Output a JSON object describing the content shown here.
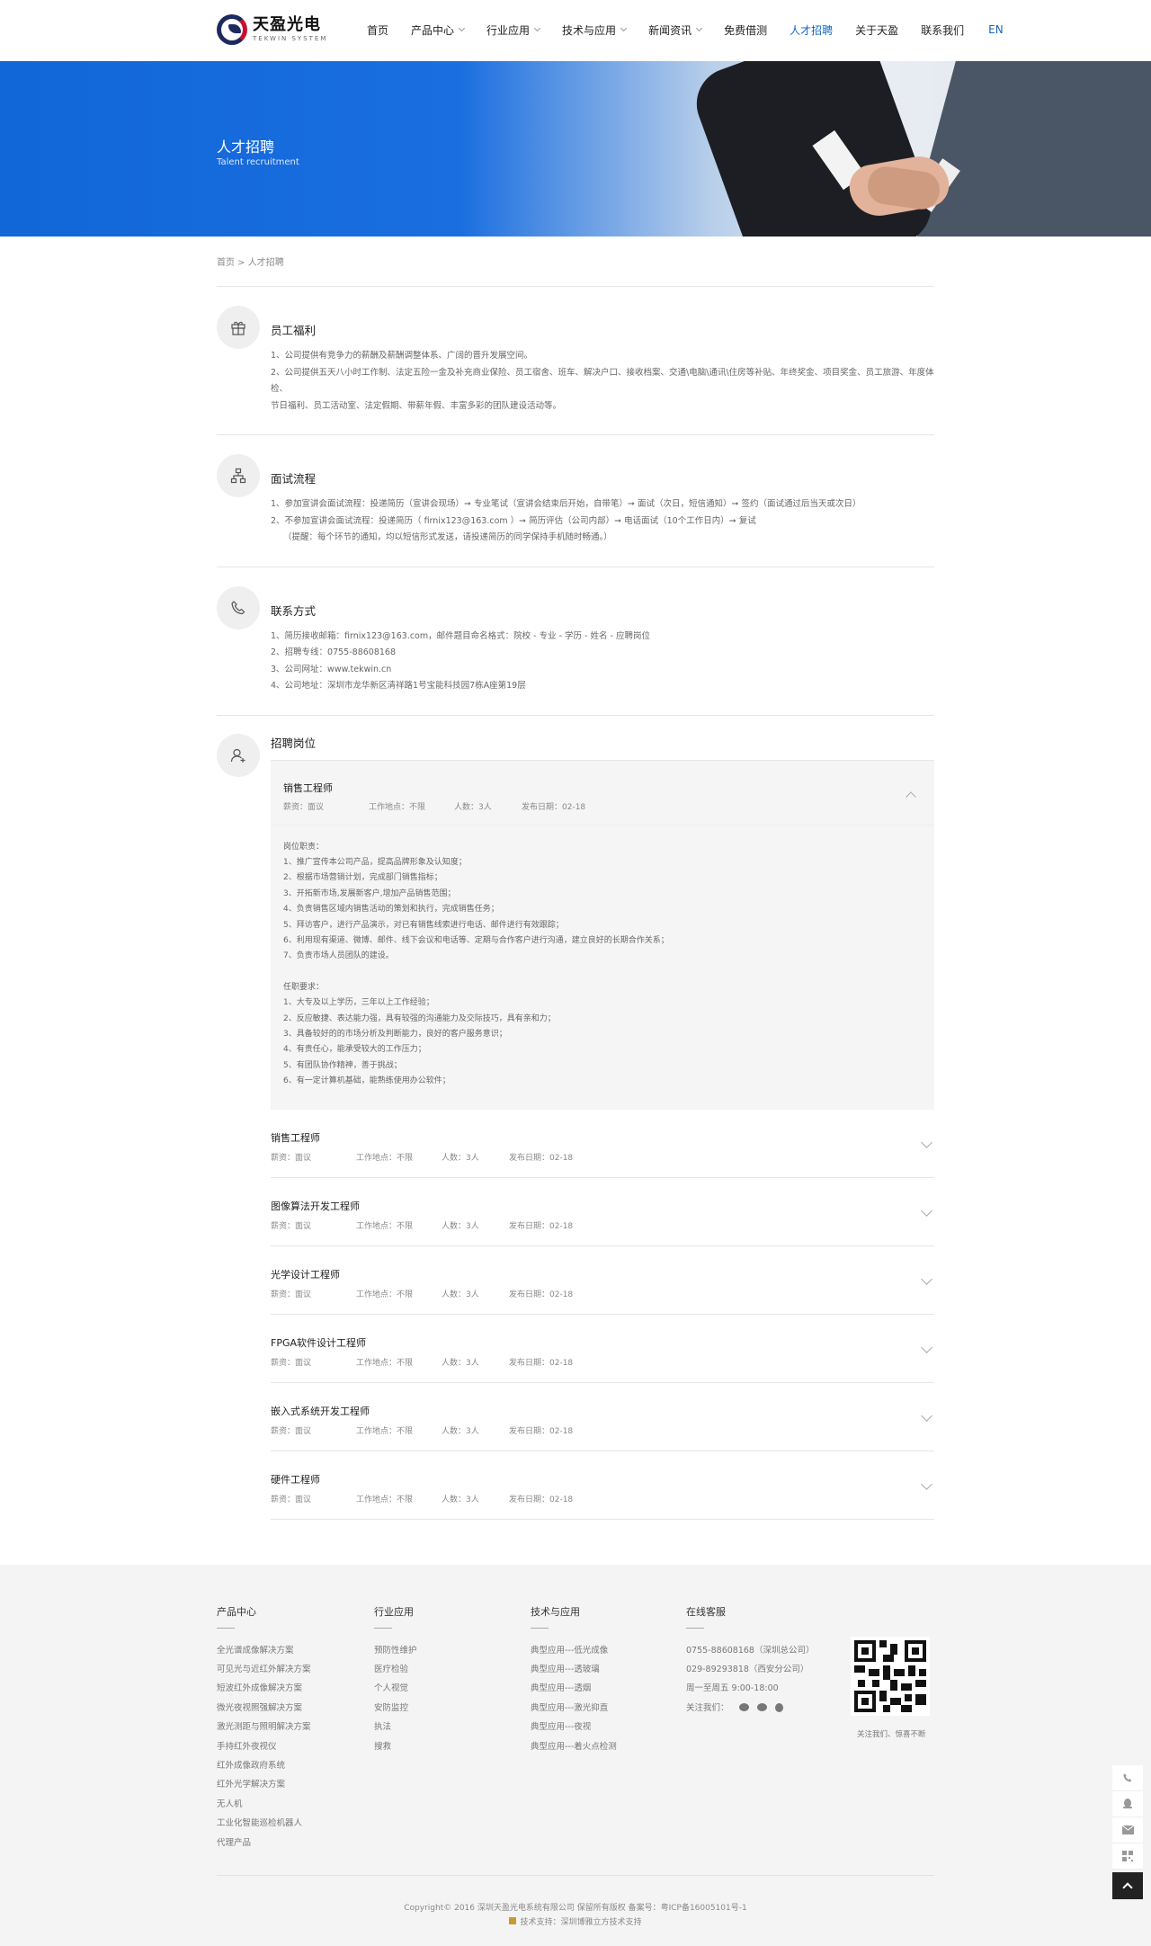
{
  "logo": {
    "cn": "天盈光电",
    "en": "TEKWIN SYSTEM"
  },
  "nav": {
    "items": [
      {
        "label": "首页",
        "caret": false,
        "active": false
      },
      {
        "label": "产品中心",
        "caret": true,
        "active": false
      },
      {
        "label": "行业应用",
        "caret": true,
        "active": false
      },
      {
        "label": "技术与应用",
        "caret": true,
        "active": false
      },
      {
        "label": "新闻资讯",
        "caret": true,
        "active": false
      },
      {
        "label": "免费借测",
        "caret": false,
        "active": false
      },
      {
        "label": "人才招聘",
        "caret": false,
        "active": true
      },
      {
        "label": "关于天盈",
        "caret": false,
        "active": false
      },
      {
        "label": "联系我们",
        "caret": false,
        "active": false
      }
    ],
    "lang": "EN"
  },
  "banner": {
    "title": "人才招聘",
    "subtitle": "Talent recruitment"
  },
  "breadcrumb": "首页 > 人才招聘",
  "welfare": {
    "title": "员工福利",
    "lines": [
      "1、公司提供有竞争力的薪酬及薪酬调整体系、广阔的晋升发展空间。",
      "2、公司提供五天八小时工作制、法定五险一金及补充商业保险、员工宿舍、班车、解决户口、接收档案、交通\\电脑\\通讯\\住房等补贴、年终奖金、项目奖金、员工旅游、年度体检、",
      "节日福利、员工活动室、法定假期、带薪年假、丰富多彩的团队建设活动等。"
    ]
  },
  "interview": {
    "title": "面试流程",
    "lines": [
      "1、参加宣讲会面试流程：投递简历（宣讲会现场）➞ 专业笔试（宣讲会结束后开始，自带笔）➞ 面试（次日，短信通知）➞ 签约（面试通过后当天或次日）",
      "2、不参加宣讲会面试流程：投递简历（ firnix123@163.com ）➞ 简历评估（公司内部）➞ 电话面试（10个工作日内）➞ 复试",
      "（提醒：每个环节的通知，均以短信形式发送，请投递简历的同学保持手机随时畅通。）"
    ]
  },
  "contact": {
    "title": "联系方式",
    "lines": [
      "1、简历接收邮箱：firnix123@163.com，邮件题目命名格式：院校 - 专业 - 学历 - 姓名 - 应聘岗位",
      "2、招聘专线：0755-88608168",
      "3、公司网址：www.tekwin.cn",
      "4、公司地址：深圳市龙华新区清祥路1号宝能科技园7栋A座第19层"
    ]
  },
  "jobs": {
    "title": "招聘岗位",
    "open": {
      "name": "销售工程师",
      "salary": "薪资：面议",
      "location": "工作地点：不限",
      "count": "人数：3人",
      "date": "发布日期：02-18",
      "details": [
        "岗位职责：",
        "1、推广宣传本公司产品，提高品牌形象及认知度；",
        "2、根据市场营销计划，完成部门销售指标；",
        "3、开拓新市场,发展新客户,增加产品销售范围；",
        "4、负责销售区域内销售活动的策划和执行，完成销售任务；",
        "5、拜访客户，进行产品演示，对已有销售线索进行电话、邮件进行有效跟踪；",
        "6、利用现有渠道、微博、邮件、线下会议和电话等、定期与合作客户进行沟通，建立良好的长期合作关系；",
        "7、负责市场人员团队的建设。",
        "",
        "任职要求：",
        "1、大专及以上学历，三年以上工作经验；",
        "2、反应敏捷、表达能力强，具有较强的沟通能力及交际技巧，具有亲和力；",
        "3、具备较好的的市场分析及判断能力，良好的客户服务意识；",
        "4、有责任心，能承受较大的工作压力；",
        "5、有团队协作精神，善于挑战；",
        "6、有一定计算机基础，能熟练使用办公软件；"
      ]
    },
    "list": [
      {
        "name": "销售工程师",
        "salary": "薪资：面议",
        "location": "工作地点：不限",
        "count": "人数：3人",
        "date": "发布日期：02-18"
      },
      {
        "name": "图像算法开发工程师",
        "salary": "薪资：面议",
        "location": "工作地点：不限",
        "count": "人数：3人",
        "date": "发布日期：02-18"
      },
      {
        "name": "光学设计工程师",
        "salary": "薪资：面议",
        "location": "工作地点：不限",
        "count": "人数：3人",
        "date": "发布日期：02-18"
      },
      {
        "name": "FPGA软件设计工程师",
        "salary": "薪资：面议",
        "location": "工作地点：不限",
        "count": "人数：3人",
        "date": "发布日期：02-18"
      },
      {
        "name": "嵌入式系统开发工程师",
        "salary": "薪资：面议",
        "location": "工作地点：不限",
        "count": "人数：3人",
        "date": "发布日期：02-18"
      },
      {
        "name": "硬件工程师",
        "salary": "薪资：面议",
        "location": "工作地点：不限",
        "count": "人数：3人",
        "date": "发布日期：02-18"
      }
    ]
  },
  "footer": {
    "products": {
      "title": "产品中心",
      "items": [
        "全光谱成像解决方案",
        "可见光与近红外解决方案",
        "短波红外成像解决方案",
        "微光夜视照强解决方案",
        "激光测距与照明解决方案",
        "手持红外夜视仪",
        "红外成像政府系统",
        "红外光学解决方案",
        "无人机",
        "工业化智能巡检机器人",
        "代理产品"
      ]
    },
    "industry": {
      "title": "行业应用",
      "items": [
        "预防性维护",
        "医疗检验",
        "个人视觉",
        "安防监控",
        "执法",
        "搜救"
      ]
    },
    "tech": {
      "title": "技术与应用",
      "items": [
        "典型应用---低光成像",
        "典型应用---透玻璃",
        "典型应用---透烟",
        "典型应用---激光抑直",
        "典型应用---夜视",
        "典型应用---着火点检测"
      ]
    },
    "service": {
      "title": "在线客服",
      "items": [
        "0755-88608168（深圳总公司）",
        "029-89293818（西安分公司）",
        "周一至周五 9:00-18:00"
      ],
      "follow": "关注我们："
    },
    "qr_caption": "关注我们、惊喜不断",
    "copyright": "Copyright© 2016 深圳天盈光电系统有限公司 保留所有版权 备案号：粤ICP备16005101号-1",
    "support": "技术支持：深圳博雅立方技术支持"
  }
}
